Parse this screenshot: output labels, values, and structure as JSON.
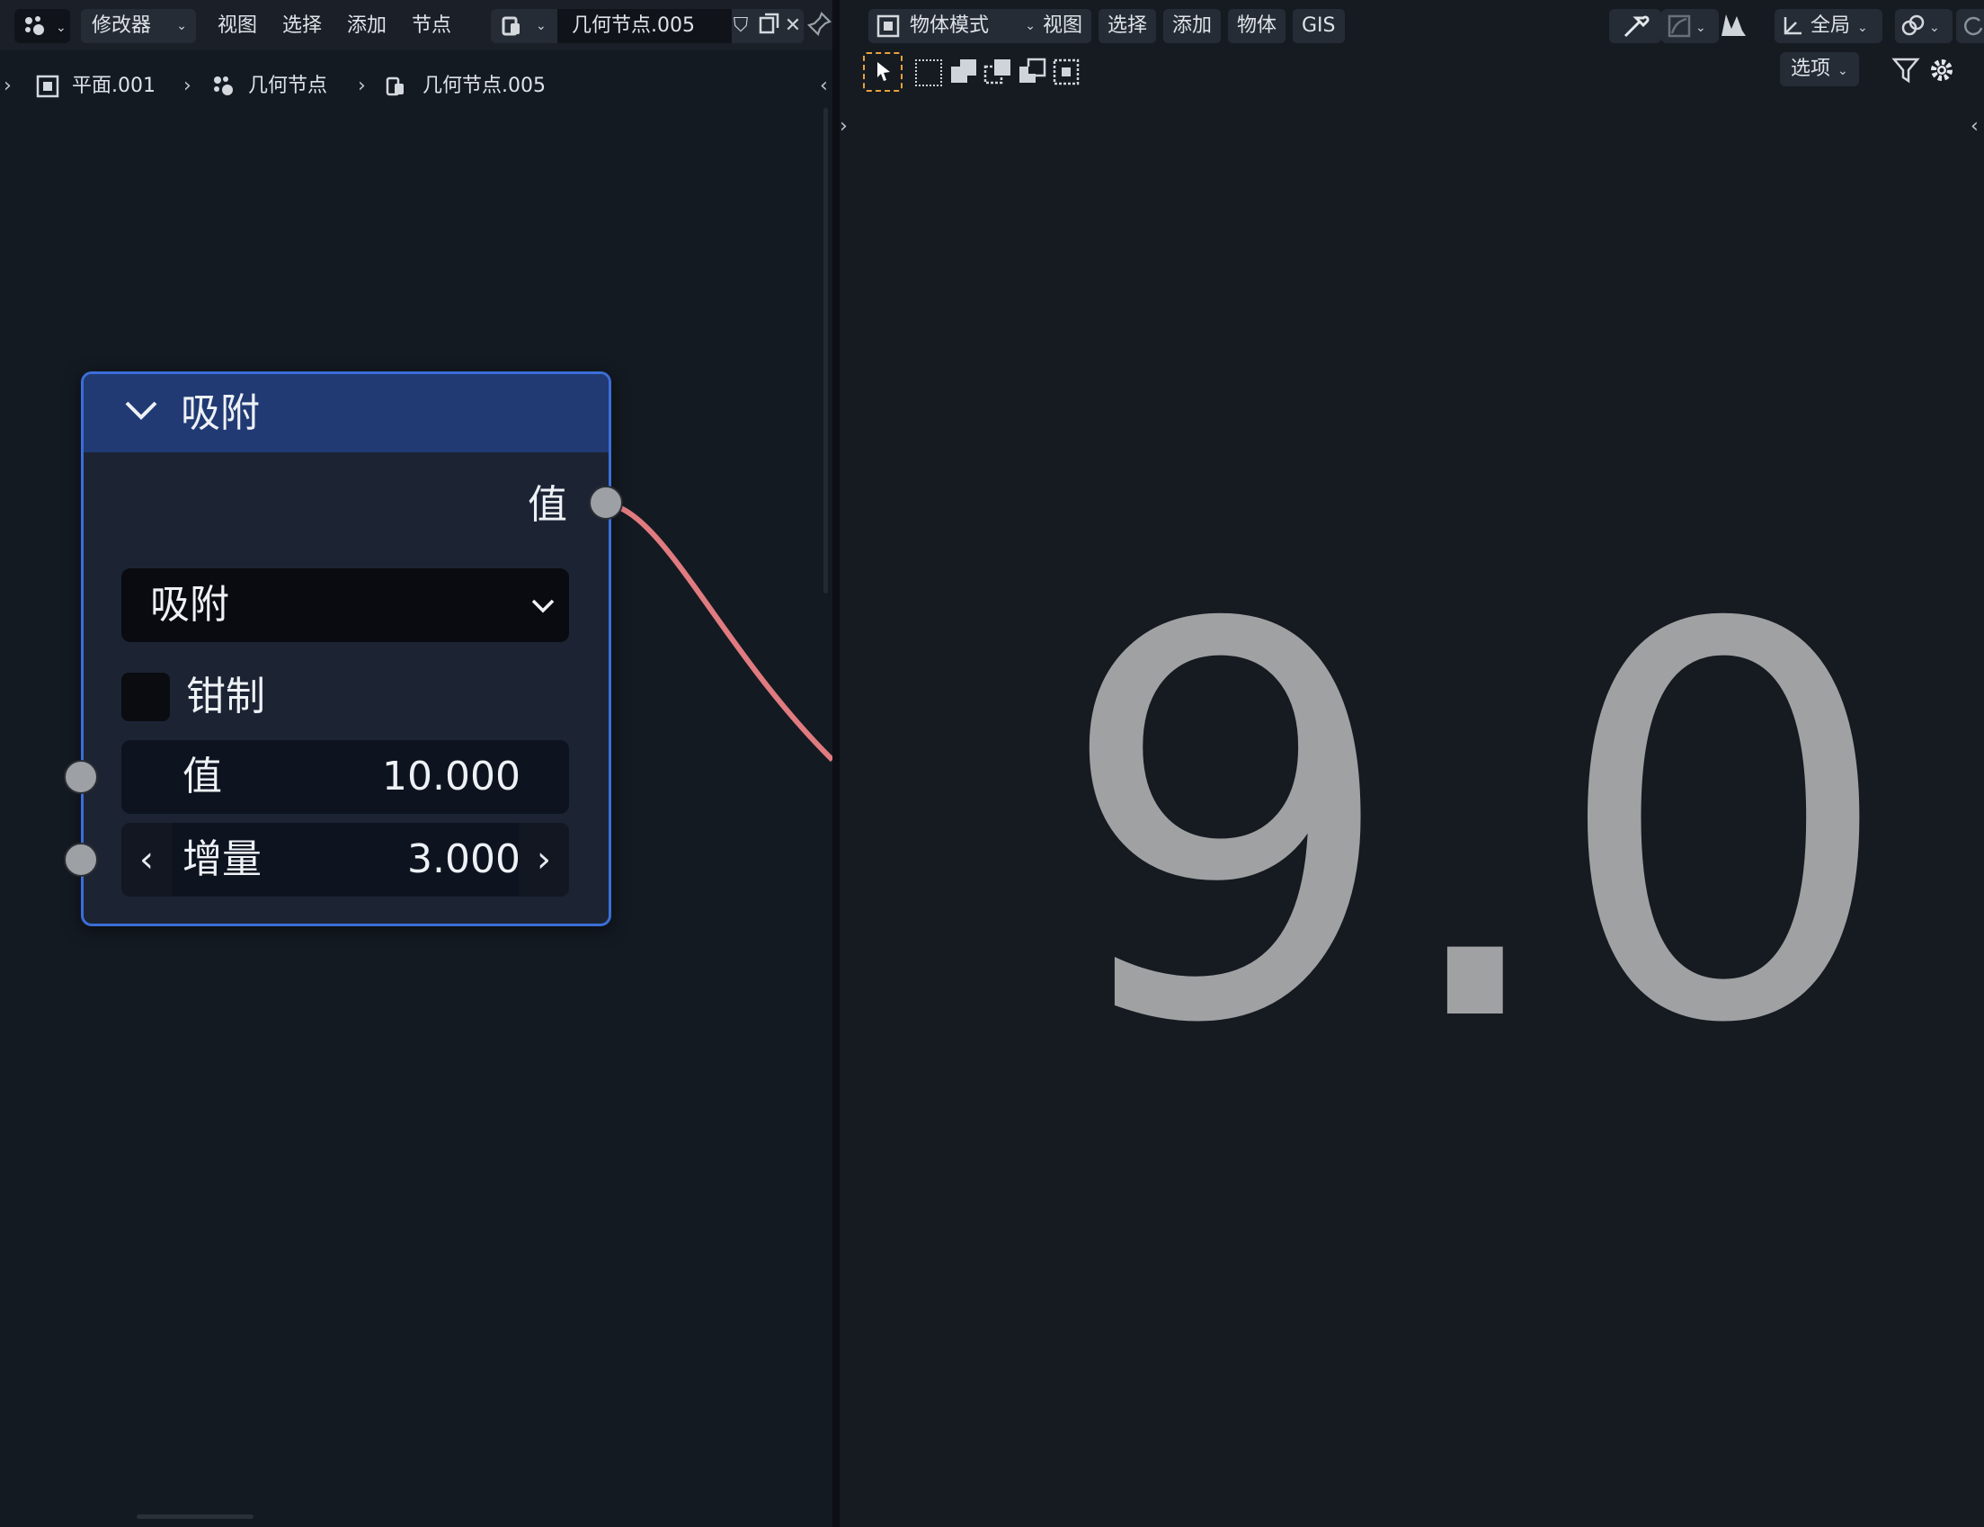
{
  "node_editor": {
    "header": {
      "editor_type_icon": "geometry-nodes-icon",
      "mode_dropdown": "修改器",
      "menus": [
        "视图",
        "选择",
        "添加",
        "节点"
      ],
      "node_group_type_icon": "node-tree-icon",
      "node_group_name": "几何节点.005",
      "fake_user_icon": "shield-icon",
      "duplicate_icon": "duplicate-icon",
      "unlink_icon": "close-icon",
      "pin_icon": "pin-icon"
    },
    "breadcrumb": {
      "items": [
        "平面.001",
        "几何节点",
        "几何节点.005"
      ]
    },
    "node": {
      "title": "吸附",
      "output_label": "值",
      "operation": "吸附",
      "clamp_label": "钳制",
      "value_label": "值",
      "value": "10.000",
      "increment_label": "增量",
      "increment": "3.000"
    },
    "link_color": "#e07b80",
    "accent_color": "#3b6ed8"
  },
  "viewport": {
    "header": {
      "mode_dropdown": "物体模式",
      "menus": [
        "视图",
        "选择",
        "添加",
        "物体",
        "GIS"
      ],
      "orientation": "全局",
      "options": "选项"
    },
    "display_text": "9.0"
  }
}
